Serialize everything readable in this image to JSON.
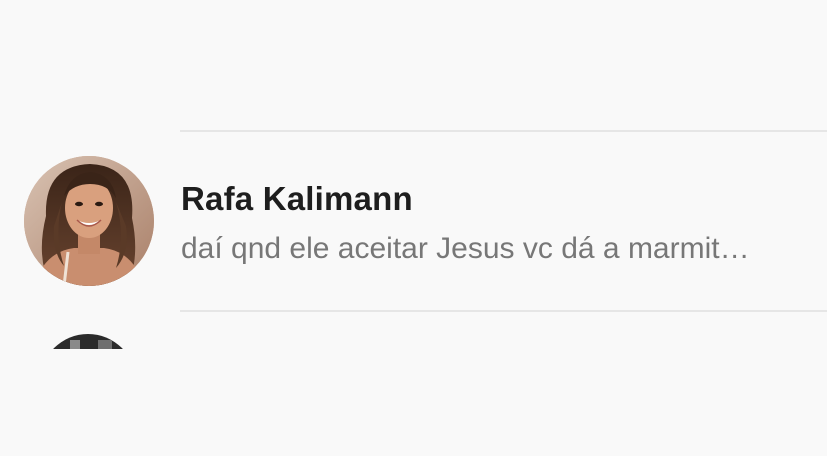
{
  "conversation": {
    "contact_name": "Rafa Kalimann",
    "last_message": "daí qnd ele aceitar Jesus vc dá a marmit…",
    "avatar_icon": "contact-photo"
  },
  "next_conversation": {
    "avatar_icon": "contact-photo"
  },
  "colors": {
    "background": "#f9f9f9",
    "divider": "#e6e6e6",
    "name": "#1e1e1e",
    "preview": "#777777"
  }
}
